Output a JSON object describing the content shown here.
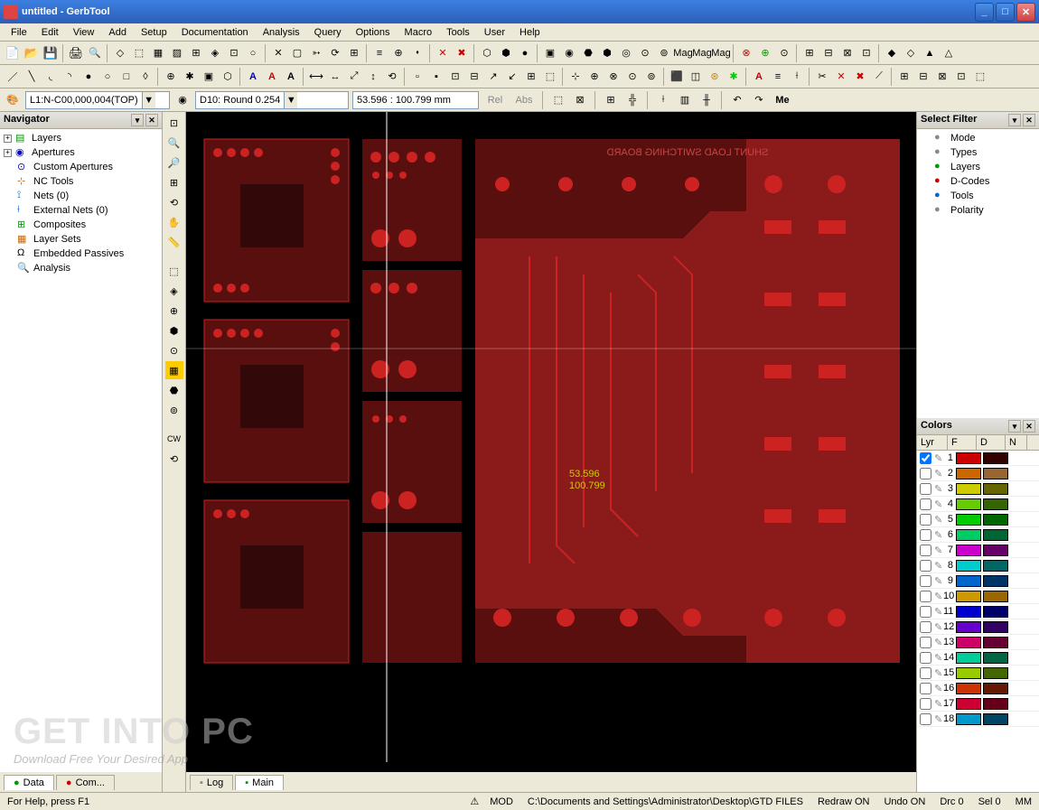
{
  "titlebar": {
    "title": "untitled - GerbTool"
  },
  "menubar": [
    "File",
    "Edit",
    "View",
    "Add",
    "Setup",
    "Documentation",
    "Analysis",
    "Query",
    "Options",
    "Macro",
    "Tools",
    "User",
    "Help"
  ],
  "controls": {
    "layer_combo": "L1:N-C00,000,004(TOP)",
    "dcode_combo": "D10: Round 0.254",
    "coord_box": "53.596 : 100.799 mm",
    "btn_rel": "Rel",
    "btn_abs": "Abs",
    "btn_me": "Me"
  },
  "navigator": {
    "title": "Navigator",
    "items": [
      {
        "icon": "layers",
        "label": "Layers",
        "expandable": true
      },
      {
        "icon": "apertures",
        "label": "Apertures",
        "expandable": true
      },
      {
        "icon": "custom",
        "label": "Custom Apertures",
        "expandable": false
      },
      {
        "icon": "nctools",
        "label": "NC Tools",
        "expandable": false
      },
      {
        "icon": "nets",
        "label": "Nets (0)",
        "expandable": false
      },
      {
        "icon": "extnets",
        "label": "External Nets (0)",
        "expandable": false
      },
      {
        "icon": "composites",
        "label": "Composites",
        "expandable": false
      },
      {
        "icon": "layersets",
        "label": "Layer Sets",
        "expandable": false
      },
      {
        "icon": "embedded",
        "label": "Embedded Passives",
        "expandable": false
      },
      {
        "icon": "analysis",
        "label": "Analysis",
        "expandable": false
      }
    ]
  },
  "canvas": {
    "coords_line1": "53.596",
    "coords_line2": "100.799"
  },
  "filter": {
    "title": "Select Filter",
    "items": [
      "Mode",
      "Types",
      "Layers",
      "D-Codes",
      "Tools",
      "Polarity"
    ]
  },
  "colors": {
    "title": "Colors",
    "headers": [
      "Lyr",
      "F",
      "D",
      "N"
    ],
    "rows": [
      {
        "n": "1",
        "checked": true,
        "c1": "#cc0000",
        "c2": "#330000"
      },
      {
        "n": "2",
        "checked": false,
        "c1": "#cc6600",
        "c2": "#996633"
      },
      {
        "n": "3",
        "checked": false,
        "c1": "#cccc00",
        "c2": "#666600"
      },
      {
        "n": "4",
        "checked": false,
        "c1": "#66cc00",
        "c2": "#336600"
      },
      {
        "n": "5",
        "checked": false,
        "c1": "#00cc00",
        "c2": "#006600"
      },
      {
        "n": "6",
        "checked": false,
        "c1": "#00cc66",
        "c2": "#006633"
      },
      {
        "n": "7",
        "checked": false,
        "c1": "#cc00cc",
        "c2": "#660066"
      },
      {
        "n": "8",
        "checked": false,
        "c1": "#00cccc",
        "c2": "#006666"
      },
      {
        "n": "9",
        "checked": false,
        "c1": "#0066cc",
        "c2": "#003366"
      },
      {
        "n": "10",
        "checked": false,
        "c1": "#cc9900",
        "c2": "#996600"
      },
      {
        "n": "11",
        "checked": false,
        "c1": "#0000cc",
        "c2": "#000066"
      },
      {
        "n": "12",
        "checked": false,
        "c1": "#6600cc",
        "c2": "#330066"
      },
      {
        "n": "13",
        "checked": false,
        "c1": "#cc0066",
        "c2": "#660033"
      },
      {
        "n": "14",
        "checked": false,
        "c1": "#00cc99",
        "c2": "#006644"
      },
      {
        "n": "15",
        "checked": false,
        "c1": "#99cc00",
        "c2": "#446600"
      },
      {
        "n": "16",
        "checked": false,
        "c1": "#cc3300",
        "c2": "#661900"
      },
      {
        "n": "17",
        "checked": false,
        "c1": "#cc0033",
        "c2": "#660019"
      },
      {
        "n": "18",
        "checked": false,
        "c1": "#0099cc",
        "c2": "#004466"
      }
    ]
  },
  "bottom_left_tabs": [
    {
      "label": "Data",
      "active": true
    },
    {
      "label": "Com...",
      "active": false
    }
  ],
  "bottom_center_tabs": [
    {
      "label": "Log",
      "active": false
    },
    {
      "label": "Main",
      "active": true
    }
  ],
  "statusbar": {
    "help": "For Help, press F1",
    "mod": "MOD",
    "path": "C:\\Documents and Settings\\Administrator\\Desktop\\GTD FILES",
    "redraw": "Redraw ON",
    "undo": "Undo ON",
    "drc": "Drc 0",
    "sel": "Sel 0",
    "unit": "MM"
  },
  "watermark": {
    "main": "GET INTO PC",
    "sub": "Download Free Your Desired App"
  }
}
